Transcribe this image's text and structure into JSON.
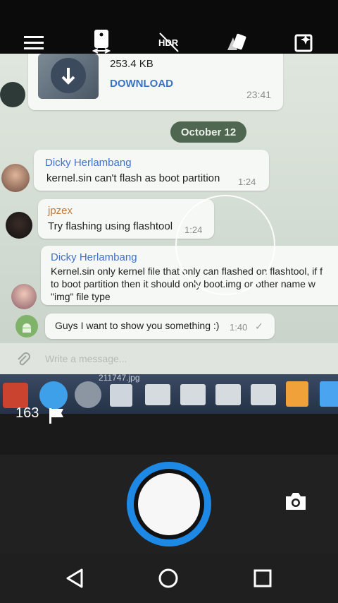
{
  "toolbar": {
    "icons": [
      "menu-icon",
      "switch-camera-icon",
      "hdr-off-icon",
      "filter-effects-icon",
      "auto-enhance-icon"
    ]
  },
  "chat": {
    "file_size": "253.4 KB",
    "download_label": "DOWNLOAD",
    "file_time": "23:41",
    "date_label": "October 12",
    "messages": [
      {
        "sender": "Dicky Herlambang",
        "text": "kernel.sin can't flash as boot partition",
        "time": "1:24",
        "sender_color": "#3f71c9"
      },
      {
        "sender": "jpzex",
        "text": "Try flashing using flashtool",
        "time": "1:24",
        "sender_color": "#c07a3c"
      },
      {
        "sender": "Dicky Herlambang",
        "text_lines": [
          "Kernel.sin only kernel file that only can flashed on flashtool, if f",
          "to boot partition then it should only boot.img or other name w",
          "\"img\" file type"
        ],
        "sender_color": "#3f71c9"
      },
      {
        "text": "Guys I want to show you something :)",
        "time": "1:40"
      }
    ],
    "compose_placeholder": "Write a message...",
    "desktop_filename": "211747.jpg"
  },
  "camera": {
    "photo_count": "163",
    "flag_icon": "flag-icon",
    "shutter_icon": "shutter-button",
    "mode_icon": "camera-mode-icon",
    "accent": "#1e88e5"
  },
  "nav": {
    "icons": [
      "back-icon",
      "home-icon",
      "recents-icon"
    ]
  }
}
